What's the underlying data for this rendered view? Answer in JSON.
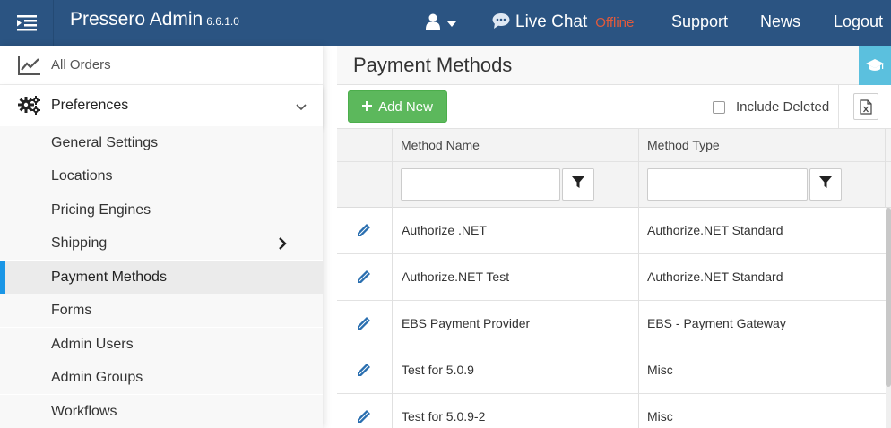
{
  "header": {
    "brand": "Pressero Admin",
    "version": "6.6.1.0",
    "live_chat": {
      "label": "Live Chat",
      "status": "Offline"
    },
    "nav": [
      {
        "label": "Support"
      },
      {
        "label": "News"
      },
      {
        "label": "Logout"
      }
    ]
  },
  "sidebar": {
    "all_orders": "All Orders",
    "preferences": "Preferences",
    "items": [
      {
        "label": "General Settings"
      },
      {
        "label": "Locations"
      },
      {
        "label": "Pricing Engines"
      },
      {
        "label": "Shipping"
      },
      {
        "label": "Payment Methods"
      },
      {
        "label": "Forms"
      },
      {
        "label": "Admin Users"
      },
      {
        "label": "Admin Groups"
      },
      {
        "label": "Workflows"
      }
    ],
    "active_item": "Payment Methods"
  },
  "page": {
    "title": "Payment Methods",
    "add_label": "Add New",
    "include_deleted_label": "Include Deleted",
    "include_deleted_checked": false
  },
  "grid": {
    "columns": [
      "Method Name",
      "Method Type"
    ],
    "filters": {
      "method_name": "",
      "method_type": ""
    },
    "rows": [
      {
        "name": "Authorize .NET",
        "type": "Authorize.NET Standard"
      },
      {
        "name": "Authorize.NET Test",
        "type": "Authorize.NET Standard"
      },
      {
        "name": "EBS Payment Provider",
        "type": "EBS - Payment Gateway"
      },
      {
        "name": "Test for 5.0.9",
        "type": "Misc"
      },
      {
        "name": "Test for 5.0.9-2",
        "type": "Misc"
      }
    ]
  },
  "colors": {
    "topbar": "#2b5482",
    "offline": "#e05a3c",
    "add_button": "#5cb85c",
    "active_indicator": "#1a96e6",
    "help_tab": "#5bc0de",
    "edit_icon": "#2a6fb0"
  },
  "icons": {
    "menu_toggle": "menu-collapse-icon",
    "user": "user-icon",
    "live_chat": "chat-bubble-icon",
    "all_orders": "line-chart-icon",
    "preferences": "gears-icon",
    "help": "graduation-cap-icon",
    "export": "excel-export-icon",
    "filter": "filter-icon",
    "edit": "pencil-icon"
  }
}
